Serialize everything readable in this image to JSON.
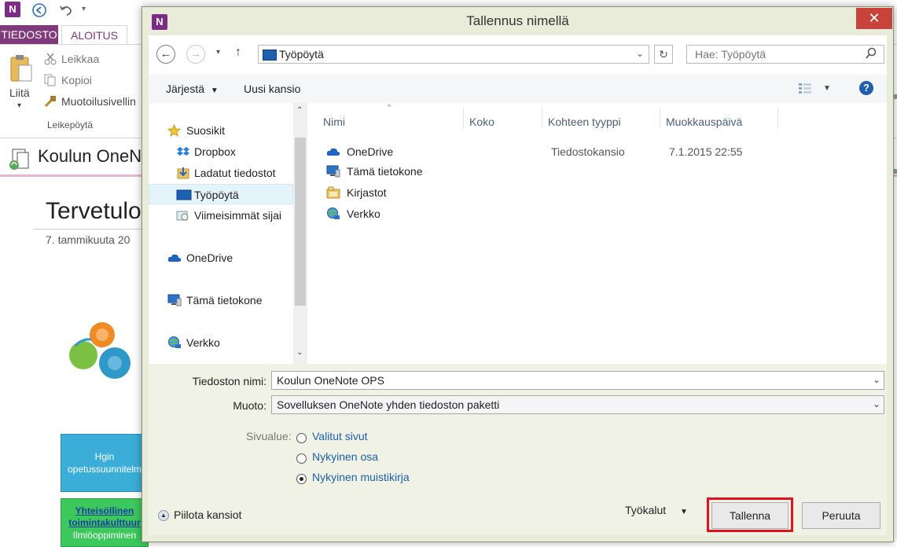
{
  "onenote": {
    "logo": "N",
    "tabs": {
      "file": "TIEDOSTO",
      "home": "ALOITUS"
    },
    "ribbon": {
      "paste": "Liitä",
      "cut": "Leikkaa",
      "copy": "Kopioi",
      "format_painter": "Muotoilusivellin",
      "group_label": "Leikepöytä"
    },
    "notebook_name": "Koulun OneN",
    "page_heading": "Tervetulo",
    "page_date": "7. tammikuuta 20",
    "boxes": {
      "blue_text": "Hgin opetussuunnitelm",
      "green_link": "Yhteisöllinen toimintakulttuur",
      "green_sub": "Ilmiöoppiminen"
    }
  },
  "dialog": {
    "title": "Tallennus nimellä",
    "close_glyph": "✕",
    "logo": "N",
    "address": "Työpöytä",
    "search_placeholder": "Hae: Työpöytä",
    "toolbar": {
      "organize": "Järjestä",
      "new_folder": "Uusi kansio"
    },
    "nav_items": [
      {
        "label": "Suosikit",
        "icon": "star-icon"
      },
      {
        "label": "Dropbox",
        "icon": "dropbox-icon"
      },
      {
        "label": "Ladatut tiedostot",
        "icon": "downloads-folder-icon"
      },
      {
        "label": "Työpöytä",
        "icon": "desktop-icon"
      },
      {
        "label": "Viimeisimmät sijai",
        "icon": "recent-places-icon"
      },
      {
        "label": "OneDrive",
        "icon": "cloud-icon"
      },
      {
        "label": "Tämä tietokone",
        "icon": "computer-icon"
      },
      {
        "label": "Verkko",
        "icon": "network-icon"
      }
    ],
    "columns": {
      "name": "Nimi",
      "size": "Koko",
      "type": "Kohteen tyyppi",
      "modified": "Muokkauspäivä"
    },
    "files": [
      {
        "name": "OneDrive",
        "type": "Tiedostokansio",
        "modified": "7.1.2015 22:55",
        "icon": "cloud-icon"
      },
      {
        "name": "Tämä tietokone",
        "type": "",
        "modified": "",
        "icon": "computer-icon"
      },
      {
        "name": "Kirjastot",
        "type": "",
        "modified": "",
        "icon": "library-icon"
      },
      {
        "name": "Verkko",
        "type": "",
        "modified": "",
        "icon": "network-icon"
      }
    ],
    "form": {
      "filename_label": "Tiedoston nimi:",
      "filename_value": "Koulun OneNote OPS",
      "format_label": "Muoto:",
      "format_value": "Sovelluksen OneNote yhden tiedoston paketti",
      "range_label": "Sivualue:",
      "range_options": [
        "Valitut sivut",
        "Nykyinen osa",
        "Nykyinen muistikirja"
      ],
      "range_selected": "Nykyinen muistikirja"
    },
    "hide_folders": "Piilota kansiot",
    "tools": "Työkalut",
    "save": "Tallenna",
    "cancel": "Peruuta"
  },
  "colors": {
    "onenote_purple": "#80397b",
    "highlight_red": "#e3111f",
    "dialog_frame": "#e8ecd8"
  }
}
